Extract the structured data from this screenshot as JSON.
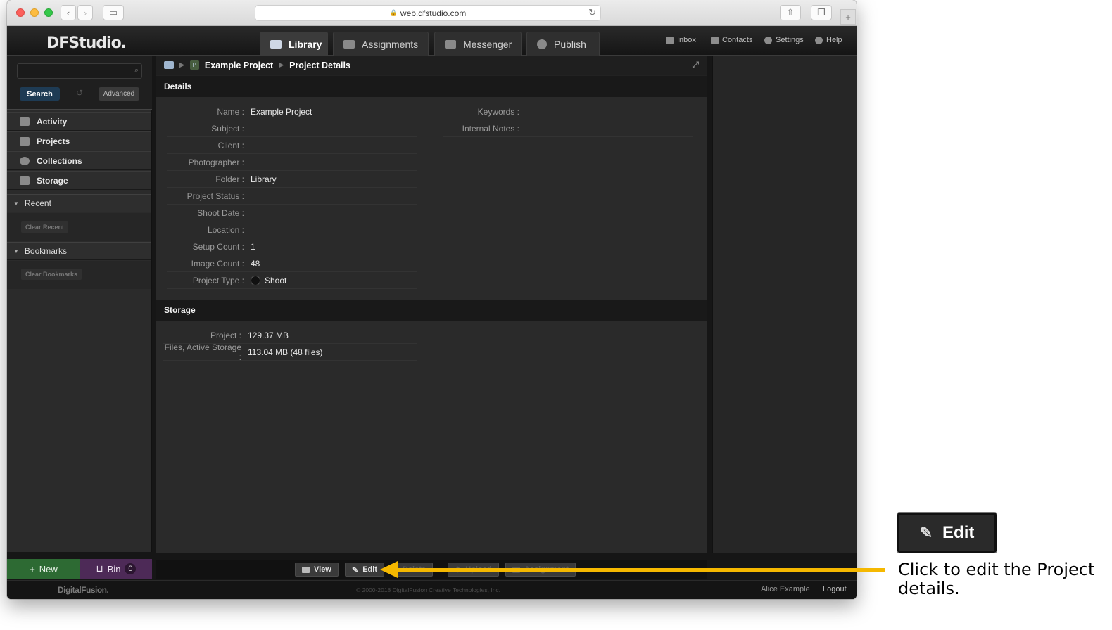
{
  "browser": {
    "url": "web.dfstudio.com",
    "new_tab_symbol": "+"
  },
  "app": {
    "logo": "DFStudio.",
    "tabs": [
      {
        "label": "Library",
        "active": true
      },
      {
        "label": "Assignments",
        "active": false
      },
      {
        "label": "Messenger",
        "active": false
      },
      {
        "label": "Publish",
        "active": false
      }
    ],
    "top_links": [
      "Inbox",
      "Contacts",
      "Settings",
      "Help"
    ]
  },
  "sidebar": {
    "search_placeholder": "",
    "search_button": "Search",
    "advanced_button": "Advanced",
    "nav": [
      "Activity",
      "Projects",
      "Collections",
      "Storage"
    ],
    "recent": {
      "label": "Recent",
      "clear": "Clear Recent"
    },
    "bookmarks": {
      "label": "Bookmarks",
      "clear": "Clear Bookmarks"
    },
    "new_button": "New",
    "bin_button": "Bin",
    "bin_count": "0"
  },
  "breadcrumb": {
    "project": "Example Project",
    "page": "Project Details",
    "project_badge": "P"
  },
  "details": {
    "header": "Details",
    "left": [
      {
        "label": "Name :",
        "value": "Example Project"
      },
      {
        "label": "Subject :",
        "value": ""
      },
      {
        "label": "Client :",
        "value": ""
      },
      {
        "label": "Photographer :",
        "value": ""
      },
      {
        "label": "Folder :",
        "value": "Library"
      },
      {
        "label": "Project Status :",
        "value": ""
      },
      {
        "label": "Shoot Date :",
        "value": ""
      },
      {
        "label": "Location :",
        "value": ""
      },
      {
        "label": "Setup Count :",
        "value": "1"
      },
      {
        "label": "Image Count :",
        "value": "48"
      },
      {
        "label": "Project Type :",
        "value": "Shoot"
      }
    ],
    "right": [
      {
        "label": "Keywords :",
        "value": ""
      },
      {
        "label": "Internal Notes :",
        "value": ""
      }
    ]
  },
  "storage": {
    "header": "Storage",
    "rows": [
      {
        "label": "Project :",
        "value": "129.37 MB"
      },
      {
        "label": "Files, Active Storage :",
        "value": "113.04 MB (48 files)"
      }
    ]
  },
  "toolbar": {
    "view": "View",
    "edit": "Edit",
    "delete": "Delete",
    "upload": "Upload",
    "assignment": "Assignment"
  },
  "footer": {
    "logo": "DigitalFusion.",
    "copyright": "© 2000-2018 DigitalFusion Creative Technologies, Inc.",
    "user": "Alice Example",
    "separator": "|",
    "logout": "Logout"
  },
  "callout": {
    "button_label": "Edit",
    "text": "Click to edit the Project details.",
    "arrow_color": "#f5b800"
  }
}
